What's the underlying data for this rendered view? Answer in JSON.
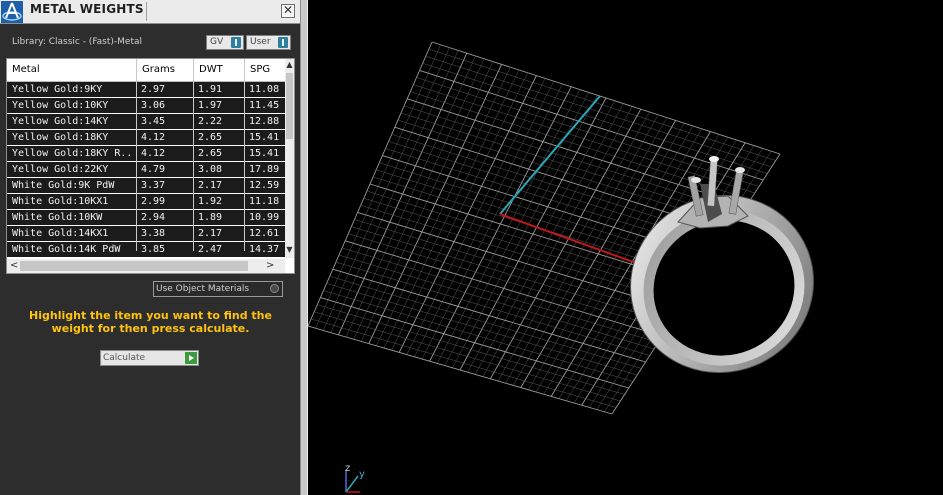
{
  "panel": {
    "title": "METAL WEIGHTS",
    "close_glyph": "✕",
    "library_label": "Library: Classic - (Fast)-Metal",
    "toggles": [
      {
        "label": "GV"
      },
      {
        "label": "User"
      }
    ],
    "table": {
      "columns": [
        "Metal",
        "Grams",
        "DWT",
        "SPG"
      ],
      "rows": [
        {
          "metal": "Yellow Gold:9KY",
          "grams": "2.97",
          "dwt": "1.91",
          "spg": "11.08"
        },
        {
          "metal": "Yellow Gold:10KY",
          "grams": "3.06",
          "dwt": "1.97",
          "spg": "11.45"
        },
        {
          "metal": "Yellow Gold:14KY",
          "grams": "3.45",
          "dwt": "2.22",
          "spg": "12.88"
        },
        {
          "metal": "Yellow Gold:18KY",
          "grams": "4.12",
          "dwt": "2.65",
          "spg": "15.41"
        },
        {
          "metal": "Yellow Gold:18KY R...",
          "grams": "4.12",
          "dwt": "2.65",
          "spg": "15.41"
        },
        {
          "metal": "Yellow Gold:22KY",
          "grams": "4.79",
          "dwt": "3.08",
          "spg": "17.89"
        },
        {
          "metal": "White Gold:9K PdW",
          "grams": "3.37",
          "dwt": "2.17",
          "spg": "12.59"
        },
        {
          "metal": "White Gold:10KX1",
          "grams": "2.99",
          "dwt": "1.92",
          "spg": "11.18"
        },
        {
          "metal": "White Gold:10KW",
          "grams": "2.94",
          "dwt": "1.89",
          "spg": "10.99"
        },
        {
          "metal": "White Gold:14KX1",
          "grams": "3.38",
          "dwt": "2.17",
          "spg": "12.61"
        },
        {
          "metal": "White Gold:14K PdW",
          "grams": "3.85",
          "dwt": "2.47",
          "spg": "14.37"
        }
      ]
    },
    "use_object_materials_label": "Use Object Materials",
    "instruction": "Highlight the item you want to find the weight for then press calculate.",
    "calculate_label": "Calculate"
  },
  "viewport": {
    "axis_labels": {
      "z": "z",
      "y": "y"
    },
    "colors": {
      "grid": "#8a8a8a",
      "y_axis": "#2aa6b8",
      "x_axis": "#c01818",
      "ring": "#c9c9c9"
    },
    "icons": {
      "logo": "app-logo-icon",
      "close": "close-icon",
      "toggle": "toggle-switch-icon",
      "calculate": "play-arrow-icon",
      "use_object": "radio-icon"
    }
  }
}
